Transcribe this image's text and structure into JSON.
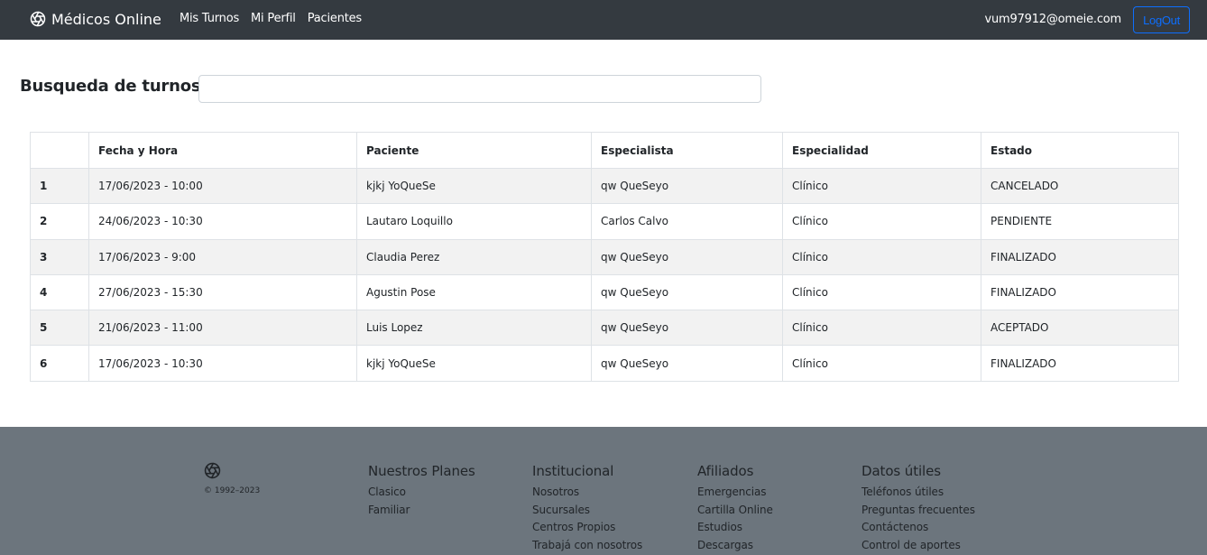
{
  "navbar": {
    "brand": "Médicos Online",
    "links": [
      "Mis Turnos",
      "Mi Perfil",
      "Pacientes"
    ],
    "user_email": "vum97912@omeie.com",
    "logout_label": "LogOut"
  },
  "search": {
    "title": "Busqueda de turnos",
    "value": ""
  },
  "table": {
    "headers": [
      "",
      "Fecha y Hora",
      "Paciente",
      "Especialista",
      "Especialidad",
      "Estado"
    ],
    "rows": [
      [
        "1",
        "17/06/2023 - 10:00",
        "kjkj YoQueSe",
        "qw QueSeyo",
        "Clínico",
        "CANCELADO"
      ],
      [
        "2",
        "24/06/2023 - 10:30",
        "Lautaro Loquillo",
        "Carlos Calvo",
        "Clínico",
        "PENDIENTE"
      ],
      [
        "3",
        "17/06/2023 - 9:00",
        "Claudia Perez",
        "qw QueSeyo",
        "Clínico",
        "FINALIZADO"
      ],
      [
        "4",
        "27/06/2023 - 15:30",
        "Agustin Pose",
        "qw QueSeyo",
        "Clínico",
        "FINALIZADO"
      ],
      [
        "5",
        "21/06/2023 - 11:00",
        "Luis Lopez",
        "qw QueSeyo",
        "Clínico",
        "ACEPTADO"
      ],
      [
        "6",
        "17/06/2023 - 10:30",
        "kjkj YoQueSe",
        "qw QueSeyo",
        "Clínico",
        "FINALIZADO"
      ]
    ]
  },
  "footer": {
    "copyright": "© 1992–2023",
    "columns": [
      {
        "title": "Nuestros Planes",
        "links": [
          "Clasico",
          "Familiar"
        ]
      },
      {
        "title": "Institucional",
        "links": [
          "Nosotros",
          "Sucursales",
          "Centros Propios",
          "Trabajá con nosotros"
        ]
      },
      {
        "title": "Afiliados",
        "links": [
          "Emergencias",
          "Cartilla Online",
          "Estudios",
          "Descargas"
        ]
      },
      {
        "title": "Datos útiles",
        "links": [
          "Teléfonos útiles",
          "Preguntas frecuentes",
          "Contáctenos",
          "Control de aportes"
        ]
      }
    ]
  },
  "colors": {
    "navbar_bg": "#343a40",
    "footer_bg": "#6c757d",
    "logout_accent": "#0d6efd",
    "striped_row": "#f2f2f2"
  },
  "icons": {
    "brand": "aperture-icon",
    "footer": "aperture-icon"
  }
}
